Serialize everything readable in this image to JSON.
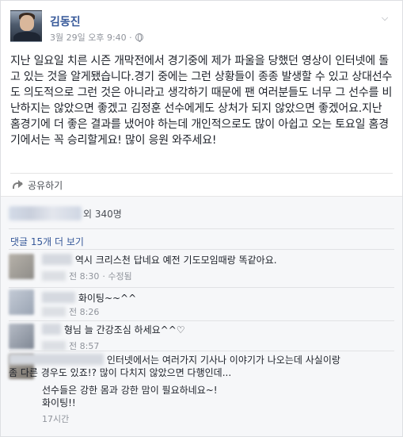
{
  "post": {
    "author": "김동진",
    "timestamp": "3월 29일 오후 9:40 ·",
    "privacy_icon": "globe-icon",
    "menu_icon": "chevron-down-icon",
    "text": "지난 일요일 치른 시즌 개막전에서 경기중에 제가 파울을 당했던 영상이 인터넷에 돌고 있는 것을 알게됐습니다.경기 중에는 그런 상황들이 종종 발생할 수 있고 상대선수도 의도적으로 그런 것은 아니라고 생각하기 때문에 팬 여러분들도 너무 그 선수를 비난하지는 않았으면 좋겠고 김정훈 선수에게도 상처가 되지 않았으면 좋겠어요.지난 홈경기에 더 좋은 결과를 냈어야 하는데 개인적으로도 많이 아쉽고 오는 토요일 홈경기에서는 꼭 승리할게요! 많이 응원 와주세요!"
  },
  "actions": {
    "share_label": "공유하기"
  },
  "reactions": {
    "count_label": "외 340명"
  },
  "comments_section": {
    "more_label": "댓글 15개 더 보기",
    "comments": [
      {
        "text": "역시 크리스천 답네요 예전 기도모임때랑 똑같아요.",
        "time": "전 8:30",
        "extra": "· 수정됨"
      },
      {
        "text": "화이팅~~^^",
        "time": "전 8:26",
        "extra": ""
      },
      {
        "text": "형님 늘 간강조심 하세요^^♡",
        "time": "전 8:57",
        "extra": ""
      },
      {
        "text_line1": "인터넷에서는 여러가지 기사나 이야기가 나오는데 사실이랑",
        "text_line2": "좀 다른 경우도 있죠!? 많이 다치지 않았으면 다행인데...",
        "text_line3": "선수들은 강한 몸과 강한 맘이 필요하네요~!",
        "text_line4": "화이팅!!",
        "time": "17시간"
      }
    ]
  },
  "colors": {
    "link": "#365899",
    "meta": "#90949c",
    "background": "#e9ebee"
  }
}
